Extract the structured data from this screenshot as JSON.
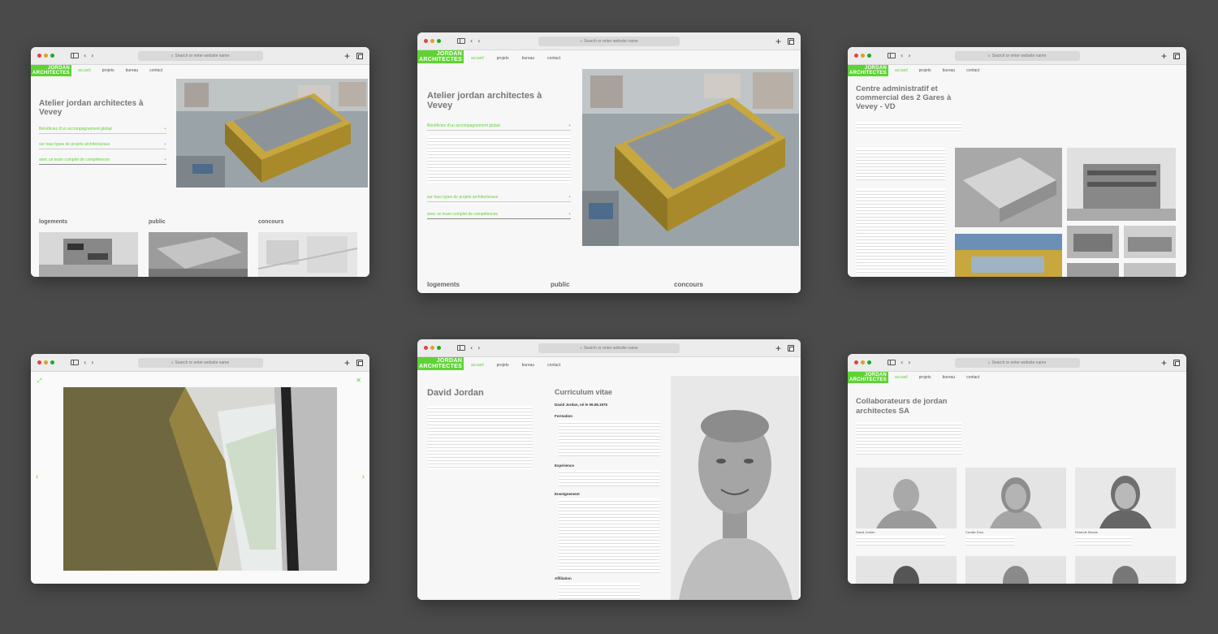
{
  "browser": {
    "address_placeholder": "Search or enter website name"
  },
  "site": {
    "logo_line1": "JORDAN",
    "logo_line2": "ARCHITECTES",
    "nav": [
      "accueil",
      "projets",
      "bureau",
      "contact"
    ]
  },
  "home": {
    "title": "Atelier jordan architectes à Vevey",
    "accordion": [
      "Bénéficiez d'un accompagnement global",
      "sur tous types de projets architecturaux",
      "avec un team complet de compétences"
    ],
    "categories": [
      "logements",
      "public",
      "concours"
    ]
  },
  "project": {
    "title": "Centre administratif et commercial des 2 Gares à Vevey - VD"
  },
  "cv": {
    "name": "David Jordan",
    "heading": "Curriculum vitae",
    "subtitle": "David Jordan, né le 09.08.1975",
    "sections": [
      "Formation",
      "Expérience",
      "Enseignement",
      "Affiliation"
    ]
  },
  "team": {
    "title": "Collaborateurs de jordan architectes SA",
    "members": [
      "David Jordan",
      "Coralie Droz",
      "Rolande Bessin"
    ]
  },
  "colors": {
    "accent": "#5fd335",
    "background": "#4a4a4a"
  }
}
